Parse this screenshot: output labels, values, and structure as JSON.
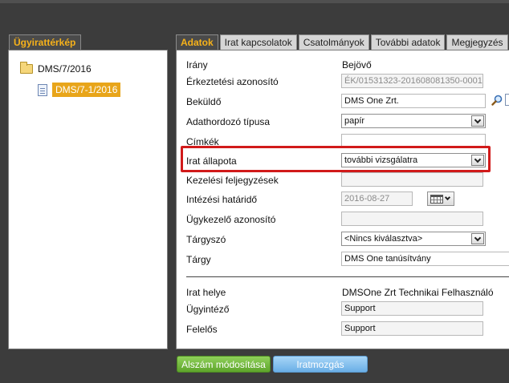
{
  "left": {
    "tab_label": "Ügyirattérkép",
    "tree": {
      "folder_label": "DMS/7/2016",
      "document_label": "DMS/7-1/2016"
    }
  },
  "tabs": [
    {
      "label": "Adatok"
    },
    {
      "label": "Irat kapcsolatok"
    },
    {
      "label": "Csatolmányok"
    },
    {
      "label": "További adatok"
    },
    {
      "label": "Megjegyzés"
    }
  ],
  "form": {
    "irany": {
      "label": "Irány",
      "value": "Bejövő"
    },
    "erkeztetesi": {
      "label": "Érkeztetési azonosító",
      "value": "ÉK/01531323-201608081350-0001"
    },
    "bekuldo": {
      "label": "Beküldő",
      "value": "DMS One Zrt."
    },
    "adathordozo": {
      "label": "Adathordozó típusa",
      "value": "papír"
    },
    "cimkek": {
      "label": "Címkék",
      "value": ""
    },
    "irat_allapota": {
      "label": "Irat állapota",
      "value": "további vizsgálatra"
    },
    "kezelesi": {
      "label": "Kezelési feljegyzések",
      "value": ""
    },
    "intezesi": {
      "label": "Intézési határidő",
      "value": "2016-08-27"
    },
    "ugykezelo": {
      "label": "Ügykezelő azonosító",
      "value": ""
    },
    "targyszo": {
      "label": "Tárgyszó",
      "value": "<Nincs kiválasztva>"
    },
    "targy": {
      "label": "Tárgy",
      "value": "DMS One tanúsítvány"
    },
    "irat_helye": {
      "label": "Irat helye",
      "value": "DMSOne Zrt Technikai Felhasználó"
    },
    "ugyintezo": {
      "label": "Ügyintéző",
      "value": "Support"
    },
    "felelos": {
      "label": "Felelős",
      "value": "Support"
    }
  },
  "buttons": {
    "alszam": "Alszám módosítása",
    "iratmozgas": "Iratmozgás"
  },
  "colors": {
    "accent": "#f7b21a",
    "selected": "#e8a51a",
    "highlight": "#d11a1a",
    "green_button": "#6cb236",
    "blue_button": "#7fbdec"
  }
}
